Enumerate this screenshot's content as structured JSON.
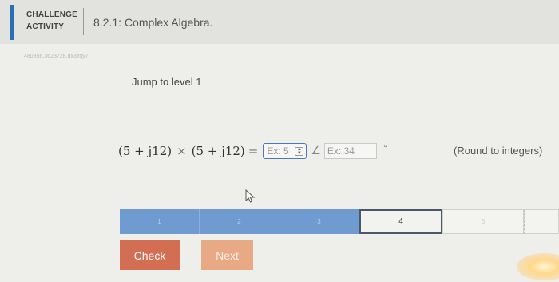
{
  "header": {
    "label_line1": "CHALLENGE",
    "label_line2": "ACTIVITY",
    "title": "8.2.1: Complex Algebra."
  },
  "meta_id": "480956.3623728.qx3zqy7",
  "jump_to_level": "Jump to level 1",
  "equation": {
    "lhs_a": "(5 + j12)",
    "times": "×",
    "lhs_b": "(5 + j12)",
    "equals": "=",
    "magnitude_placeholder": "Ex: 5",
    "angle_symbol": "∠",
    "angle_placeholder": "Ex: 34",
    "degree_symbol": "°",
    "instruction": "(Round to integers)"
  },
  "levels": [
    {
      "label": "1",
      "state": "done"
    },
    {
      "label": "2",
      "state": "done"
    },
    {
      "label": "3",
      "state": "done"
    },
    {
      "label": "4",
      "state": "current"
    },
    {
      "label": "5",
      "state": "todo"
    }
  ],
  "buttons": {
    "check": "Check",
    "next": "Next"
  },
  "colors": {
    "accent": "#2c6eb5",
    "level_done": "#6f9bd1",
    "check_button": "#d46e52",
    "next_button": "#e8a984"
  }
}
